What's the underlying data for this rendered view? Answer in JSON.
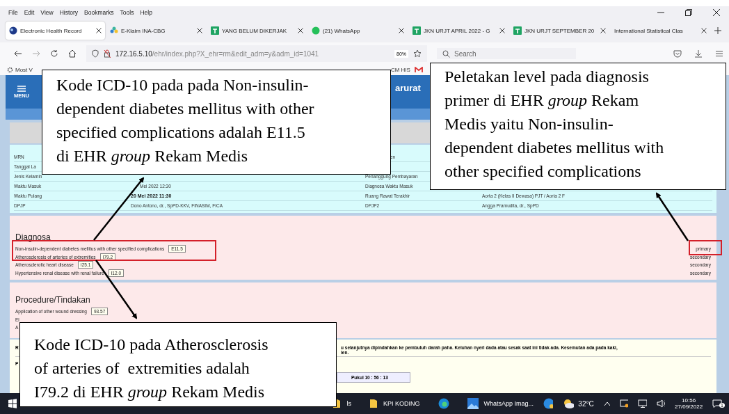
{
  "menu_bar": [
    "File",
    "Edit",
    "View",
    "History",
    "Bookmarks",
    "Tools",
    "Help"
  ],
  "tabs": [
    {
      "label": "Electronic Health Record",
      "kind": "globe",
      "selected": true
    },
    {
      "label": "E-Klaim INA-CBG",
      "kind": "flower",
      "selected": false
    },
    {
      "label": "YANG BELUM DIKERJAK",
      "kind": "sheet",
      "selected": false
    },
    {
      "label": "(21) WhatsApp",
      "kind": "chat",
      "selected": false
    },
    {
      "label": "JKN URJT APRIL 2022 - G",
      "kind": "sheet",
      "selected": false
    },
    {
      "label": "JKN URJT SEPTEMBER 20",
      "kind": "sheet",
      "selected": false
    },
    {
      "label": "International Statistical Clas",
      "kind": "plain",
      "selected": false
    }
  ],
  "address_bar": {
    "host": "172.16.5.10",
    "path": "/ehr/index.php?X_ehr=rm&edit_adm=y&adm_id=1041",
    "zoom": "80%"
  },
  "search": {
    "placeholder": "Search"
  },
  "bookmarks": [
    "Most V",
    "CM HIS"
  ],
  "header": {
    "menu_label": "MENU",
    "title": "arurat"
  },
  "info_rows": [
    {
      "left_label": "MRN",
      "right_label": "en"
    },
    {
      "left_label": "Tanggal La"
    },
    {
      "left_label": "Jenis Kelamin",
      "right_label": "Penanggung Pembayaran"
    },
    {
      "left_label": "Waktu Masuk",
      "left_value": "Mei 2022 12:30",
      "right_label": "Diagnosa Waktu Masuk",
      "value_bold": false
    },
    {
      "left_label": "Waktu Pulang",
      "left_value": "20 Mei 2022 11:30",
      "right_label": "Ruang Rawat Terakhir",
      "right_value": "Aorta 2 (Kelas II Dewasa) PJT / Aorta 2 F",
      "value_bold": true
    },
    {
      "left_label": "DPJP",
      "left_value": "Dono Antono, dr., SpPD-KKV, FINASIM, FICA",
      "right_label": "DPJP2",
      "right_value": "Angga Pramudita, dr., SpPD",
      "value_bold": false
    }
  ],
  "diagnosa": {
    "title": "Diagnosa",
    "items": [
      {
        "name": "Non-insulin-dependent diabetes mellitus with other specified complications",
        "code": "E11.5",
        "level": "primary"
      },
      {
        "name": "Atherosclerosis of arteries of extremities",
        "code": "I79.2",
        "level": "secondary"
      },
      {
        "name": "Atherosclerotic heart disease",
        "code": "I25.1",
        "level": "secondary"
      },
      {
        "name": "Hypertensive renal disease with renal failure",
        "code": "I12.0",
        "level": "secondary"
      }
    ]
  },
  "procedure": {
    "title": "Procedure/Tindakan",
    "items": [
      {
        "name": "Application of other wound dressing",
        "code": "93.57"
      },
      {
        "name": "El"
      },
      {
        "name": "A"
      }
    ]
  },
  "notes": {
    "label_1": "R",
    "text": "u selanjutnya dipindahkan ke pembuluh darah paha. Keluhan nyeri dada atau sesak saat ini tidak ada. Kesemutan ada pada kaki,",
    "text_2": "ien.",
    "label_2": "P",
    "time": "Pukul 10 : 56 : 13"
  },
  "taskbar": {
    "items": [
      {
        "label": "ls",
        "kind": "folder"
      },
      {
        "label": "KPI KODING",
        "kind": "folder"
      },
      {
        "kind": "edge"
      },
      {
        "label": "WhatsApp Imag...",
        "kind": "photo"
      }
    ],
    "weather": "32°C",
    "time": "10:56",
    "date": "27/09/2022",
    "notifications": "1"
  },
  "callouts": [
    {
      "text": "Kode ICD-10 pada pada Non-insulin-\ndependent diabetes mellitus with other\nspecified complications adalah E11.5\ndi EHR *group* Rekam Medis"
    },
    {
      "text": "Peletakan level pada diagnosis\nprimer di EHR *group* Rekam\nMedis yaitu Non-insulin-\ndependent diabetes mellitus with\nother specified complications"
    },
    {
      "text": "Kode ICD-10 pada Atherosclerosis\nof arteries of  extremities adalah\nI79.2 di EHR *group* Rekam Medis"
    }
  ]
}
